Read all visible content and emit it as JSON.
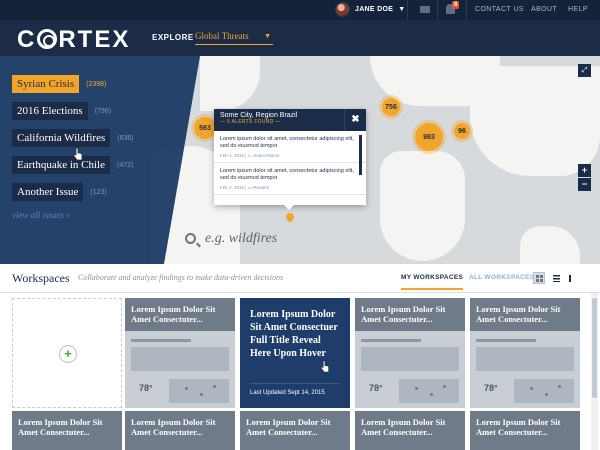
{
  "topbar": {
    "user_name": "JANE DOE",
    "notification_count": "8",
    "links": [
      "CONTACT US",
      "ABOUT",
      "HELP"
    ]
  },
  "header": {
    "logo": "CORTEX",
    "explore_label": "EXPLORE",
    "explore_value": "Global Threats"
  },
  "issues": [
    {
      "label": "Syrian Crisis",
      "count": "(2398)",
      "active": true
    },
    {
      "label": "2016 Elections",
      "count": "(798)",
      "active": false
    },
    {
      "label": "California Wildfires",
      "count": "(636)",
      "active": false
    },
    {
      "label": "Earthquake in Chile",
      "count": "(472)",
      "active": false
    },
    {
      "label": "Another Issue",
      "count": "(123)",
      "active": false
    }
  ],
  "view_all": "view all issues »",
  "map": {
    "clusters": [
      "563",
      "756",
      "983",
      "96"
    ],
    "popup": {
      "title": "Some City, Region Brazil",
      "subtitle": "— 5 ALERTS FOUND —",
      "alerts": [
        {
          "text": "Lorem ipsum dolor sit amet, consectetur adipiscing elit, sed do eiusmod tempor",
          "date": "Feb 4, 2016",
          "source": "SourceName"
        },
        {
          "text": "Lorem ipsum dolor sit amet, consectetur adipiscing elit, sed do eiusmod tempor",
          "date": "Feb 3, 2016",
          "source": "Reuters"
        }
      ]
    },
    "zoom_in": "+",
    "zoom_out": "−",
    "search_placeholder": "e.g. wildfires"
  },
  "workspaces": {
    "title": "Workspaces",
    "description": "Collaborate and analyze findings to make data-driven decisions",
    "tabs": [
      "MY WORKSPACES",
      "ALL WORKSPACES"
    ],
    "card_title": "Lorem Ipsum Dolor Sit Amet Consectuter...",
    "hover_title": "Lorem Ipsum Dolor Sit Amet Consectuer Full Title Reveal Here Upon Hover",
    "hover_updated": "Last Updated Sept 14, 2015",
    "thumb_stat": "78°"
  }
}
